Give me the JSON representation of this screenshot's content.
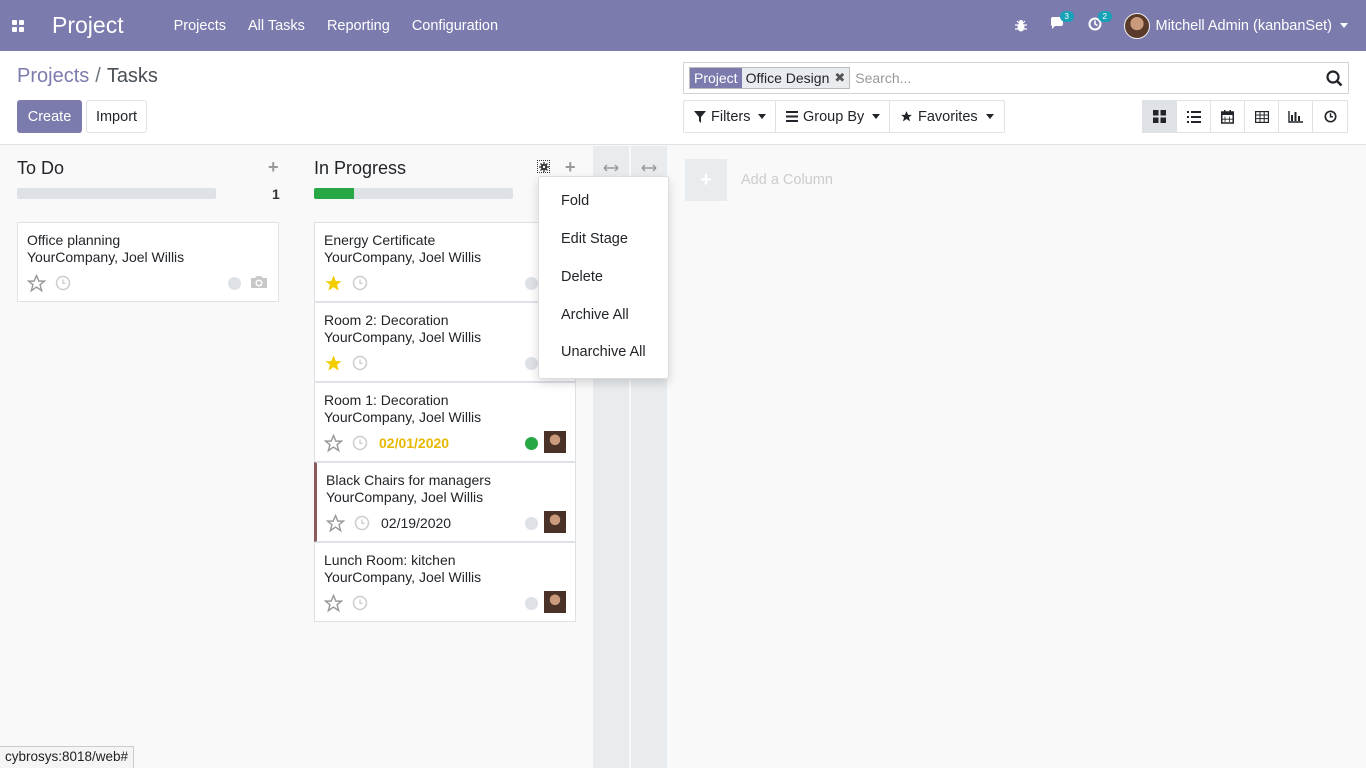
{
  "navbar": {
    "app_title": "Project",
    "menu": [
      "Projects",
      "All Tasks",
      "Reporting",
      "Configuration"
    ],
    "messages_count": "3",
    "activities_count": "2",
    "user_name": "Mitchell Admin (kanbanSet)"
  },
  "breadcrumb": {
    "parent": "Projects",
    "separator": "/",
    "current": "Tasks"
  },
  "buttons": {
    "create": "Create",
    "import": "Import"
  },
  "search": {
    "facet_category": "Project",
    "facet_value": "Office Design",
    "placeholder": "Search..."
  },
  "filters": {
    "filters": "Filters",
    "group_by": "Group By",
    "favorites": "Favorites"
  },
  "views": [
    "kanban",
    "list",
    "calendar",
    "pivot",
    "graph",
    "activity"
  ],
  "columns": [
    {
      "name": "To Do",
      "count": "1",
      "cards": [
        {
          "title": "Office planning",
          "subtitle": "YourCompany, Joel Willis",
          "starred": false,
          "date": "",
          "status": "grey"
        }
      ]
    },
    {
      "name": "In Progress",
      "progress": 0.2,
      "cards": [
        {
          "title": "Energy Certificate",
          "subtitle": "YourCompany, Joel Willis",
          "starred": true,
          "date": "",
          "status": "grey"
        },
        {
          "title": "Room 2: Decoration",
          "subtitle": "YourCompany, Joel Willis",
          "starred": true,
          "date": "",
          "status": "grey"
        },
        {
          "title": "Room 1: Decoration",
          "subtitle": "YourCompany, Joel Willis",
          "starred": false,
          "date": "02/01/2020",
          "status": "green"
        },
        {
          "title": "Black Chairs for managers",
          "subtitle": "YourCompany, Joel Willis",
          "starred": false,
          "date": "02/19/2020",
          "status": "grey"
        },
        {
          "title": "Lunch Room: kitchen",
          "subtitle": "YourCompany, Joel Willis",
          "starred": false,
          "date": "",
          "status": "grey"
        }
      ]
    }
  ],
  "add_column": "Add a Column",
  "stage_menu": [
    "Fold",
    "Edit Stage",
    "Delete",
    "Archive All",
    "Unarchive All"
  ],
  "status_url": "cybrosys:8018/web#",
  "colors": {
    "brand": "#7c7bad",
    "success": "#28a745",
    "warning": "#e6b800"
  }
}
